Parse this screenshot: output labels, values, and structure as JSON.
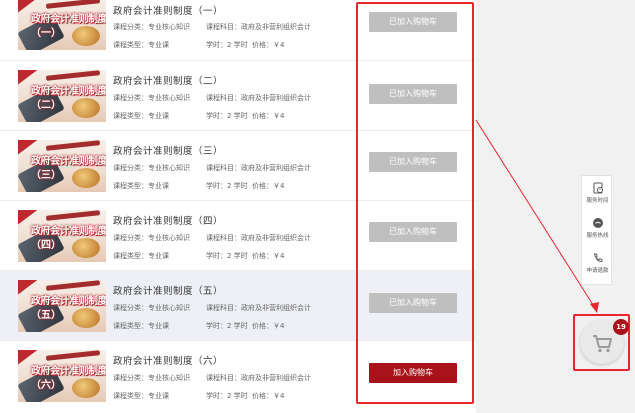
{
  "courses": [
    {
      "title": "政府会计准则制度（一）",
      "thumb_title": "政府会计准则制度",
      "thumb_sub": "（一）",
      "category": "课程分类：专业核心知识",
      "subject": "课程科目：政府及非营利组织会计",
      "type": "课程类型：专业课",
      "hours": "学时：2 学时",
      "price": "价格：￥4",
      "button": "已加入购物车",
      "in_cart": true
    },
    {
      "title": "政府会计准则制度（二）",
      "thumb_title": "政府会计准则制度",
      "thumb_sub": "（二）",
      "category": "课程分类：专业核心知识",
      "subject": "课程科目：政府及非营利组织会计",
      "type": "课程类型：专业课",
      "hours": "学时：2 学时",
      "price": "价格：￥4",
      "button": "已加入购物车",
      "in_cart": true
    },
    {
      "title": "政府会计准则制度（三）",
      "thumb_title": "政府会计准则制度",
      "thumb_sub": "（三）",
      "category": "课程分类：专业核心知识",
      "subject": "课程科目：政府及非营利组织会计",
      "type": "课程类型：专业课",
      "hours": "学时：2 学时",
      "price": "价格：￥4",
      "button": "已加入购物车",
      "in_cart": true
    },
    {
      "title": "政府会计准则制度（四）",
      "thumb_title": "政府会计准则制度",
      "thumb_sub": "（四）",
      "category": "课程分类：专业核心知识",
      "subject": "课程科目：政府及非营利组织会计",
      "type": "课程类型：专业课",
      "hours": "学时：2 学时",
      "price": "价格：￥4",
      "button": "已加入购物车",
      "in_cart": true
    },
    {
      "title": "政府会计准则制度（五）",
      "thumb_title": "政府会计准则制度",
      "thumb_sub": "（五）",
      "category": "课程分类：专业核心知识",
      "subject": "课程科目：政府及非营利组织会计",
      "type": "课程类型：专业课",
      "hours": "学时：2 学时",
      "price": "价格：￥4",
      "button": "已加入购物车",
      "in_cart": true
    },
    {
      "title": "政府会计准则制度（六）",
      "thumb_title": "政府会计准则制度",
      "thumb_sub": "（六）",
      "category": "课程分类：专业核心知识",
      "subject": "课程科目：政府及非营利组织会计",
      "type": "课程类型：专业课",
      "hours": "学时：2 学时",
      "price": "价格：￥4",
      "button": "加入购物车",
      "in_cart": false
    }
  ],
  "sidebar": {
    "items": [
      {
        "label": "服务时间",
        "icon": "clock-icon"
      },
      {
        "label": "服务热线",
        "icon": "chat-icon"
      },
      {
        "label": "申请退款",
        "icon": "phone-icon"
      }
    ]
  },
  "cart": {
    "count": "19",
    "icon": "cart-icon"
  },
  "colors": {
    "accent": "#a8131b",
    "annotation": "#e8262d",
    "disabled_button": "#bfbfbf"
  }
}
